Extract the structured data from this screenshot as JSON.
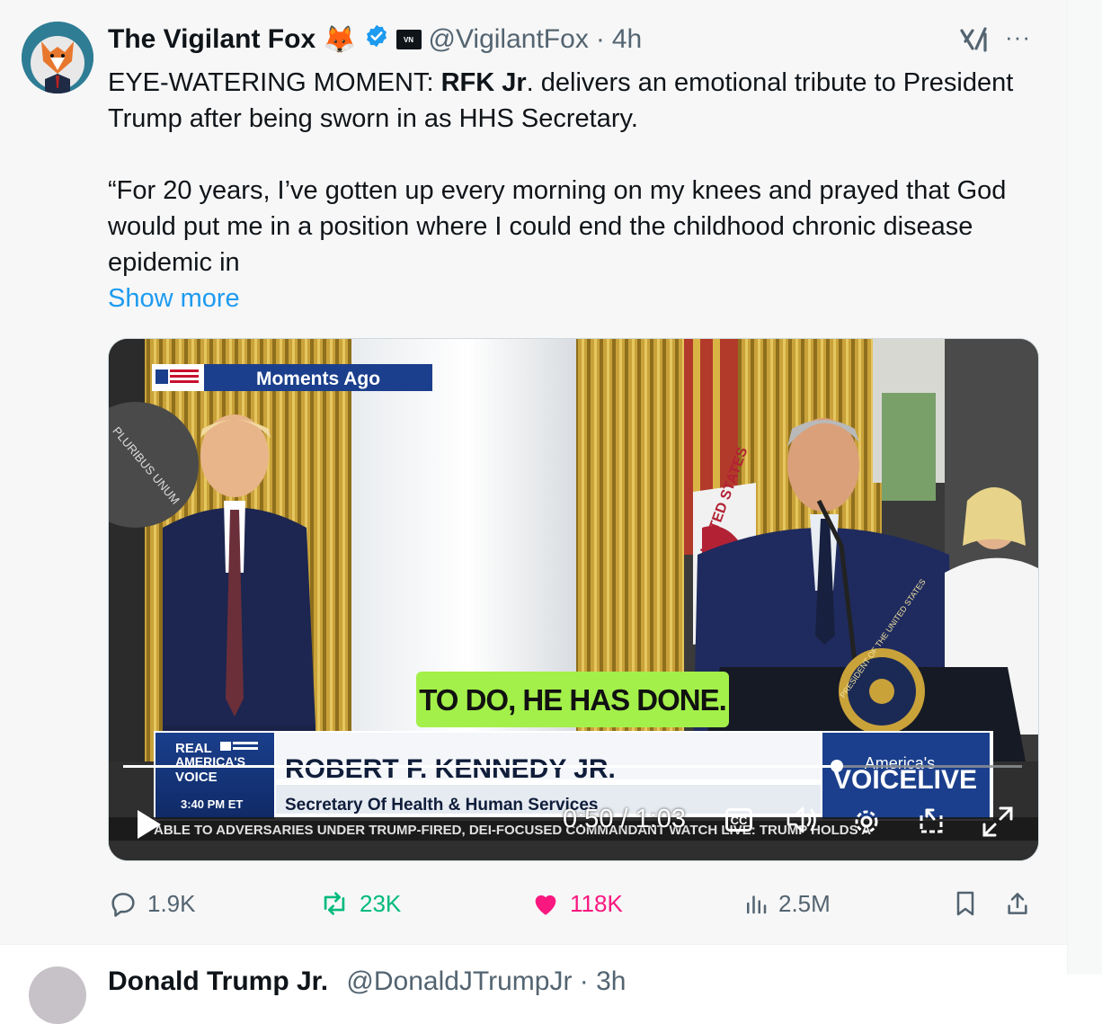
{
  "tweet": {
    "author_name": "The Vigilant Fox",
    "author_emoji": "🦊",
    "affiliate_badge": "VN",
    "handle": "@VigilantFox",
    "separator": "·",
    "time": "4h",
    "more_label": "···",
    "text_prefix": "EYE-WATERING MOMENT: ",
    "text_bold": "RFK Jr",
    "text_rest": ". delivers an emotional tribute to President Trump after being sworn in as HHS Secretary.",
    "quote": "“For 20 years, I’ve gotten up every morning on my knees and prayed that God would put me in a position where I could end the childhood chronic disease epidemic in",
    "show_more": "Show more"
  },
  "video": {
    "banner_moments": "Moments Ago",
    "caption": "TO DO, HE HAS DONE.",
    "network_line1": "REAL",
    "network_line2": "AMERICA'S",
    "network_line3": "VOICE",
    "network_time": "3:40 PM ET",
    "lower_third_name": "ROBERT F. KENNEDY JR.",
    "lower_third_title": "Secretary Of Health & Human Services",
    "brand_top": "America's",
    "brand_bottom": "VOICELIVE",
    "ticker": "ABLE TO ADVERSARIES UNDER TRUMP-FIRED, DEI-FOCUSED COMMANDANT  WATCH LIVE: TRUMP HOLDS A",
    "seal_text": "PRESIDENT OF THE UNITED STATES",
    "flag_text": "UNITED STATES",
    "pluribus_text": "PLURIBUS UNUM",
    "time_display": "0:50 / 1:03",
    "cc_label": "CC",
    "progress": 0.794
  },
  "metrics": {
    "replies": "1.9K",
    "reposts": "23K",
    "likes": "118K",
    "views": "2.5M"
  },
  "next_tweet": {
    "author_partial": "Donald Trump Jr.",
    "handle_partial": "@DonaldJTrumpJr · 3h"
  },
  "colors": {
    "link_blue": "#1d9bf0",
    "verified_blue": "#1d9bf0",
    "repost_green": "#00ba7c",
    "like_pink": "#f91880",
    "caption_green": "#a3f04a",
    "muted": "#536471"
  }
}
